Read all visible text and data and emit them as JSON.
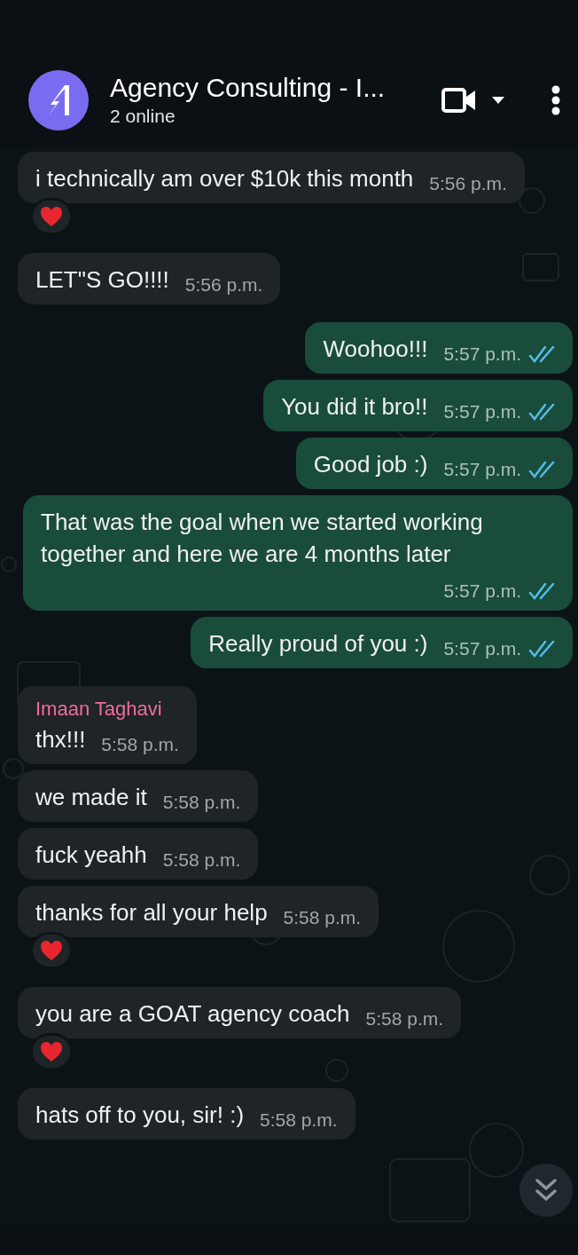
{
  "header": {
    "title": "Agency Consulting - I...",
    "subtitle": "2 online"
  },
  "messages": [
    {
      "kind": "in",
      "text": "i technically am over $10k this month",
      "time": "5:56 p.m.",
      "reacted": true
    },
    {
      "kind": "in",
      "text": "LET\"S GO!!!!",
      "time": "5:56 p.m.",
      "reacted": false
    },
    {
      "kind": "out",
      "text": "Woohoo!!!",
      "time": "5:57 p.m.",
      "read": true
    },
    {
      "kind": "out",
      "text": "You did it bro!!",
      "time": "5:57 p.m.",
      "read": true
    },
    {
      "kind": "out",
      "text": "Good job :)",
      "time": "5:57 p.m.",
      "read": true
    },
    {
      "kind": "out",
      "text": "That was the goal when we started working together and here we are 4 months later",
      "time": "5:57 p.m.",
      "read": true
    },
    {
      "kind": "out",
      "text": "Really proud of you :)",
      "time": "5:57 p.m.",
      "read": true
    },
    {
      "kind": "in",
      "sender": "Imaan Taghavi",
      "text": "thx!!!",
      "time": "5:58 p.m.",
      "reacted": false
    },
    {
      "kind": "in",
      "text": "we made it",
      "time": "5:58 p.m.",
      "reacted": false
    },
    {
      "kind": "in",
      "text": "fuck yeahh",
      "time": "5:58 p.m.",
      "reacted": false
    },
    {
      "kind": "in",
      "text": "thanks for all your help",
      "time": "5:58 p.m.",
      "reacted": true
    },
    {
      "kind": "in",
      "text": "you are a GOAT agency coach",
      "time": "5:58 p.m.",
      "reacted": true
    },
    {
      "kind": "in",
      "text": "hats off to you, sir! :)",
      "time": "5:58 p.m.",
      "reacted": false
    }
  ]
}
